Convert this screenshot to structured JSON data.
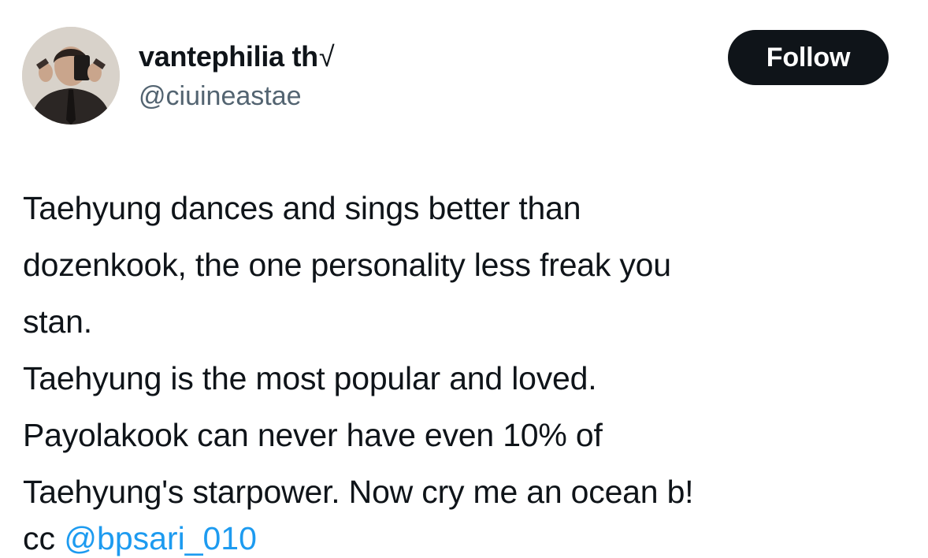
{
  "author": {
    "display_name": "vantephilia th",
    "verified_symbol": "√",
    "handle": "@ciuineastae",
    "avatar_icon": "profile-photo"
  },
  "follow_button": {
    "label": "Follow",
    "bg_color": "#0f1419",
    "text_color": "#ffffff"
  },
  "tweet": {
    "lines": [
      "Taehyung dances and sings better than",
      "dozenkook, the one personality less freak you",
      "stan.",
      "Taehyung is the most popular and loved.",
      "Payolakook can never have even 10% of",
      "Taehyung's starpower. Now cry me an ocean b!"
    ],
    "trailing_prefix": "cc",
    "trailing_mention": "@bpsari_010"
  },
  "colors": {
    "text": "#0f1419",
    "secondary_text": "#536471",
    "link": "#1d9bf0",
    "background": "#ffffff"
  }
}
